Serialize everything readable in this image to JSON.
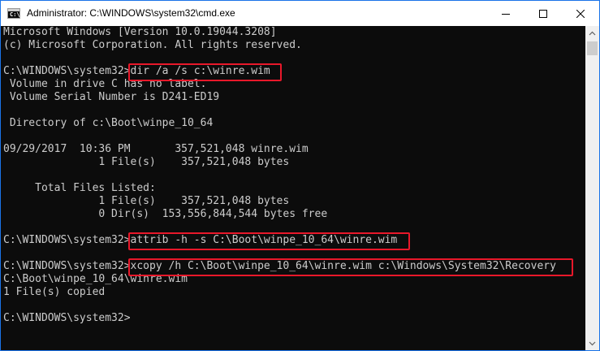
{
  "window": {
    "title": "Administrator: C:\\WINDOWS\\system32\\cmd.exe",
    "icon": "cmd-icon",
    "icon_text": "C:\\",
    "controls": [
      "minimize-icon",
      "maximize-icon",
      "close-icon"
    ]
  },
  "console": {
    "lines": [
      "Microsoft Windows [Version 10.0.19044.3208]",
      "(c) Microsoft Corporation. All rights reserved.",
      "",
      "C:\\WINDOWS\\system32>dir /a /s c:\\winre.wim",
      " Volume in drive C has no label.",
      " Volume Serial Number is D241-ED19",
      "",
      " Directory of c:\\Boot\\winpe_10_64",
      "",
      "09/29/2017  10:36 PM       357,521,048 winre.wim",
      "               1 File(s)    357,521,048 bytes",
      "",
      "     Total Files Listed:",
      "               1 File(s)    357,521,048 bytes",
      "               0 Dir(s)  153,556,844,544 bytes free",
      "",
      "C:\\WINDOWS\\system32>attrib -h -s C:\\Boot\\winpe_10_64\\winre.wim",
      "",
      "C:\\WINDOWS\\system32>xcopy /h C:\\Boot\\winpe_10_64\\winre.wim c:\\Windows\\System32\\Recovery",
      "C:\\Boot\\winpe_10_64\\winre.wim",
      "1 File(s) copied",
      "",
      "C:\\WINDOWS\\system32>"
    ],
    "text_color": "#cccccc",
    "background_color": "#0c0c0c",
    "highlight_color": "#e8182a"
  }
}
